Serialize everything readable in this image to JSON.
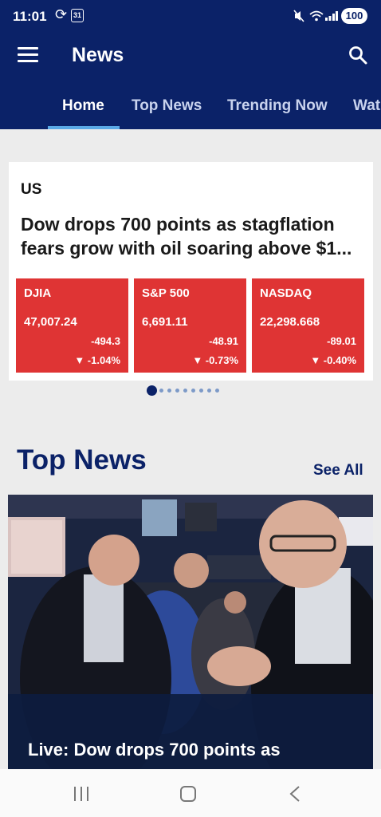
{
  "status": {
    "time": "11:01",
    "calendar_day": "31",
    "battery": "100",
    "icons": [
      "sync-icon",
      "calendar-icon",
      "mute-icon",
      "wifi-icon",
      "signal-icon",
      "battery-icon"
    ]
  },
  "appbar": {
    "title": "News",
    "icons": [
      "menu-icon",
      "search-icon"
    ],
    "background": "#0b2268"
  },
  "tabs": [
    {
      "label": "Home",
      "active": true
    },
    {
      "label": "Top News",
      "active": false
    },
    {
      "label": "Trending Now",
      "active": false
    },
    {
      "label": "Wat",
      "active": false
    }
  ],
  "market": {
    "region": "US",
    "headline_line1": "Dow drops 700 points as stagflation",
    "headline_line2": "fears grow with oil soaring above $1...",
    "tile_color": "#df3434",
    "indices": [
      {
        "name": "DJIA",
        "value": "47,007.24",
        "change": "-494.3",
        "pct": "▼ -1.04%"
      },
      {
        "name": "S&P 500",
        "value": "6,691.11",
        "change": "-48.91",
        "pct": "▼ -0.73%"
      },
      {
        "name": "NASDAQ",
        "value": "22,298.668",
        "change": "-89.01",
        "pct": "▼ -0.40%"
      }
    ],
    "carousel_pages": 9,
    "carousel_active": 1
  },
  "top_news": {
    "title": "Top News",
    "see_all": "See All",
    "story_title": "Live: Dow drops 700 points as"
  }
}
